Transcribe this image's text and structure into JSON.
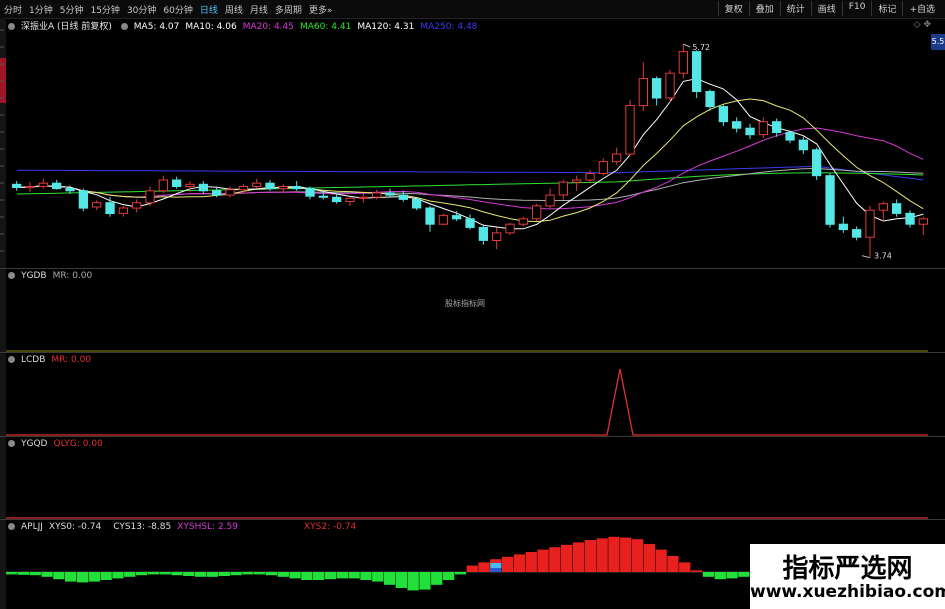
{
  "toolbar": {
    "periods": [
      "分时",
      "1分钟",
      "5分钟",
      "15分钟",
      "30分钟",
      "60分钟",
      "日线",
      "周线",
      "月线",
      "多周期",
      "更多»"
    ],
    "active_period": "日线",
    "right_buttons": [
      "复权",
      "叠加",
      "统计",
      "画线",
      "F10",
      "标记",
      "+自选"
    ]
  },
  "main_panel": {
    "title": "深振业A (日线 前复权)",
    "ma": [
      {
        "label": "MA5: 4.07",
        "color": "#ffffff"
      },
      {
        "label": "MA10: 4.06",
        "color": "#ffffff"
      },
      {
        "label": "MA20: 4.45",
        "color": "#d43ad4"
      },
      {
        "label": "MA60: 4.41",
        "color": "#2fe32f"
      },
      {
        "label": "MA120: 4.31",
        "color": "#ffffff"
      },
      {
        "label": "MA250: 4.48",
        "color": "#3a3af0"
      }
    ],
    "high_label": "5.72",
    "low_label": "3.74",
    "badge": "5.5"
  },
  "panels": [
    {
      "name": "YGDB",
      "items": [
        {
          "label": "MR: 0.00",
          "color": "#cccccc"
        }
      ],
      "watermark": "股标指标网"
    },
    {
      "name": "LCDB",
      "items": [
        {
          "label": "MR: 0.00",
          "color": "#e03030"
        }
      ]
    },
    {
      "name": "YGQD",
      "items": [
        {
          "label": "QLYG: 0.00",
          "color": "#e03030"
        }
      ]
    },
    {
      "name": "APLJJ",
      "items": [
        {
          "label": "XYS0: -0.74",
          "color": "#dddddd"
        },
        {
          "label": "CYS13: -8.85",
          "color": "#dddddd"
        },
        {
          "label": "XYSHSL: 2.59",
          "color": "#d43ad4"
        },
        {
          "label": "XYS2: -0.74",
          "color": "#e03030"
        }
      ]
    }
  ],
  "watermark": {
    "title": "指标严选网",
    "url": "www.xuezhibiao.com"
  },
  "colors": {
    "up": "#e03a3a",
    "down": "#55e6e6",
    "ma5": "#ffffff",
    "ma10": "#e8e870",
    "ma20": "#d43ad4",
    "ma60": "#2fe32f",
    "ma120": "#b0b0b0",
    "ma250": "#3a3af0"
  },
  "chart_data": [
    {
      "type": "candlestick",
      "title": "深振业A (日线 前复权)",
      "candles": [
        [
          4.42,
          4.45,
          4.36,
          4.39
        ],
        [
          4.39,
          4.44,
          4.35,
          4.4
        ],
        [
          4.4,
          4.47,
          4.38,
          4.43
        ],
        [
          4.43,
          4.46,
          4.37,
          4.38
        ],
        [
          4.38,
          4.41,
          4.33,
          4.36
        ],
        [
          4.36,
          4.38,
          4.17,
          4.2
        ],
        [
          4.21,
          4.27,
          4.18,
          4.25
        ],
        [
          4.25,
          4.3,
          4.12,
          4.15
        ],
        [
          4.15,
          4.22,
          4.12,
          4.2
        ],
        [
          4.2,
          4.28,
          4.16,
          4.25
        ],
        [
          4.25,
          4.4,
          4.22,
          4.36
        ],
        [
          4.36,
          4.5,
          4.34,
          4.46
        ],
        [
          4.46,
          4.49,
          4.38,
          4.4
        ],
        [
          4.4,
          4.45,
          4.35,
          4.42
        ],
        [
          4.42,
          4.45,
          4.33,
          4.36
        ],
        [
          4.36,
          4.4,
          4.3,
          4.32
        ],
        [
          4.32,
          4.4,
          4.3,
          4.37
        ],
        [
          4.37,
          4.42,
          4.34,
          4.4
        ],
        [
          4.4,
          4.47,
          4.38,
          4.43
        ],
        [
          4.43,
          4.46,
          4.36,
          4.38
        ],
        [
          4.38,
          4.42,
          4.35,
          4.4
        ],
        [
          4.4,
          4.45,
          4.36,
          4.38
        ],
        [
          4.38,
          4.4,
          4.28,
          4.31
        ],
        [
          4.31,
          4.36,
          4.28,
          4.3
        ],
        [
          4.3,
          4.33,
          4.24,
          4.26
        ],
        [
          4.26,
          4.3,
          4.22,
          4.29
        ],
        [
          4.29,
          4.33,
          4.25,
          4.3
        ],
        [
          4.3,
          4.37,
          4.28,
          4.34
        ],
        [
          4.34,
          4.38,
          4.3,
          4.32
        ],
        [
          4.32,
          4.36,
          4.26,
          4.28
        ],
        [
          4.28,
          4.3,
          4.18,
          4.2
        ],
        [
          4.2,
          4.22,
          3.98,
          4.05
        ],
        [
          4.05,
          4.15,
          4.04,
          4.13
        ],
        [
          4.13,
          4.17,
          4.08,
          4.1
        ],
        [
          4.1,
          4.14,
          4.0,
          4.02
        ],
        [
          4.02,
          4.05,
          3.86,
          3.9
        ],
        [
          3.9,
          4.02,
          3.82,
          3.97
        ],
        [
          3.97,
          4.06,
          3.95,
          4.05
        ],
        [
          4.05,
          4.12,
          4.03,
          4.1
        ],
        [
          4.1,
          4.24,
          4.08,
          4.22
        ],
        [
          4.22,
          4.38,
          4.2,
          4.32
        ],
        [
          4.32,
          4.46,
          4.28,
          4.44
        ],
        [
          4.44,
          4.5,
          4.36,
          4.46
        ],
        [
          4.46,
          4.55,
          4.43,
          4.52
        ],
        [
          4.52,
          4.66,
          4.5,
          4.63
        ],
        [
          4.63,
          4.76,
          4.6,
          4.7
        ],
        [
          4.7,
          5.2,
          4.68,
          5.15
        ],
        [
          5.15,
          5.55,
          5.1,
          5.4
        ],
        [
          5.4,
          5.42,
          5.15,
          5.22
        ],
        [
          5.22,
          5.48,
          5.18,
          5.45
        ],
        [
          5.45,
          5.72,
          5.4,
          5.65
        ],
        [
          5.65,
          5.66,
          5.22,
          5.28
        ],
        [
          5.28,
          5.3,
          5.1,
          5.14
        ],
        [
          5.14,
          5.16,
          4.96,
          5.0
        ],
        [
          5.0,
          5.04,
          4.9,
          4.94
        ],
        [
          4.94,
          4.98,
          4.84,
          4.88
        ],
        [
          4.88,
          5.04,
          4.85,
          5.0
        ],
        [
          5.0,
          5.03,
          4.86,
          4.9
        ],
        [
          4.9,
          4.92,
          4.8,
          4.83
        ],
        [
          4.83,
          4.86,
          4.7,
          4.74
        ],
        [
          4.74,
          4.76,
          4.46,
          4.5
        ],
        [
          4.5,
          4.52,
          4.02,
          4.05
        ],
        [
          4.05,
          4.12,
          3.97,
          4.0
        ],
        [
          4.0,
          4.03,
          3.9,
          3.93
        ],
        [
          3.93,
          4.22,
          3.74,
          4.18
        ],
        [
          4.18,
          4.26,
          4.08,
          4.24
        ],
        [
          4.24,
          4.28,
          4.12,
          4.15
        ],
        [
          4.15,
          4.18,
          4.02,
          4.05
        ],
        [
          4.05,
          4.12,
          3.95,
          4.1
        ]
      ],
      "high_marker": {
        "label": "5.72",
        "value": 5.72
      },
      "low_marker": {
        "label": "3.74",
        "value": 3.74
      },
      "ylim": [
        3.7,
        5.85
      ]
    },
    {
      "type": "line",
      "name": "YGDB",
      "series": [
        {
          "name": "MR",
          "values": [
            0
          ]
        }
      ]
    },
    {
      "type": "line",
      "name": "LCDB",
      "series": [
        {
          "name": "MR",
          "spike_value": 1,
          "baseline": 0
        }
      ]
    },
    {
      "type": "line",
      "name": "YGQD",
      "series": [
        {
          "name": "QLYG",
          "values": [
            0
          ]
        }
      ]
    },
    {
      "type": "bar",
      "name": "APLJJ",
      "values": [
        -0.3,
        -0.35,
        -0.4,
        -0.6,
        -0.9,
        -1.2,
        -1.3,
        -1.2,
        -1.0,
        -0.8,
        -0.6,
        -0.4,
        -0.3,
        -0.3,
        -0.4,
        -0.5,
        -0.6,
        -0.6,
        -0.5,
        -0.4,
        -0.3,
        -0.3,
        -0.4,
        -0.6,
        -0.8,
        -1.0,
        -1.0,
        -0.9,
        -0.8,
        -0.8,
        -1.0,
        -1.2,
        -1.6,
        -2.0,
        -2.3,
        -2.2,
        -1.6,
        -1.0,
        -0.3,
        0.8,
        1.2,
        1.6,
        1.9,
        2.2,
        2.5,
        2.8,
        3.1,
        3.4,
        3.7,
        4.0,
        4.2,
        4.4,
        4.3,
        4.1,
        3.5,
        2.8,
        2.0,
        1.2,
        0.2,
        -0.6,
        -0.9,
        -0.8,
        -0.6
      ]
    }
  ]
}
